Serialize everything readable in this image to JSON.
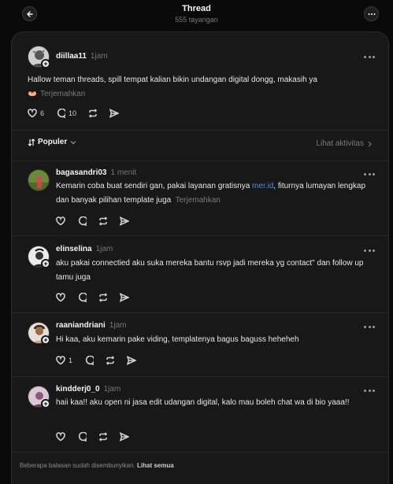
{
  "header": {
    "title": "Thread",
    "views": "555 tayangan"
  },
  "op": {
    "username": "diillaa11",
    "time": "1jam",
    "text": "Hallow teman threads, spill tempat kalian bikin undangan digital dongg, makasih ya",
    "translate": "Terjemahkan",
    "likes": "6",
    "comments": "10"
  },
  "sort": {
    "label": "Populer",
    "activity": "Lihat aktivitas"
  },
  "replies": [
    {
      "username": "bagasandri03",
      "time": "1 menit",
      "text_before": "Kemarin coba buat sendiri gan, pakai layanan gratisnya ",
      "link": "mer.id",
      "text_after": ", fiturnya lumayan lengkap dan banyak pilihan template juga",
      "translate": "Terjemahkan"
    },
    {
      "username": "elinselina",
      "time": "1jam",
      "text": "aku pakai connectied aku suka mereka bantu rsvp jadi mereka yg contact\" dan follow up tamu juga"
    },
    {
      "username": "raaniandriani",
      "time": "1jam",
      "text": "Hi kaa, aku kemarin pake viding, templatenya bagus baguss heheheh",
      "likes": "1"
    },
    {
      "username": "kindderj0_0",
      "time": "1jam",
      "text": "haii kaa!! aku open ni jasa edit udangan digital, kalo mau boleh chat wa di bio yaaa!!"
    }
  ],
  "footer": {
    "text": "Beberapa balasan sudah disembunyikan.",
    "link": "Lihat semua"
  }
}
